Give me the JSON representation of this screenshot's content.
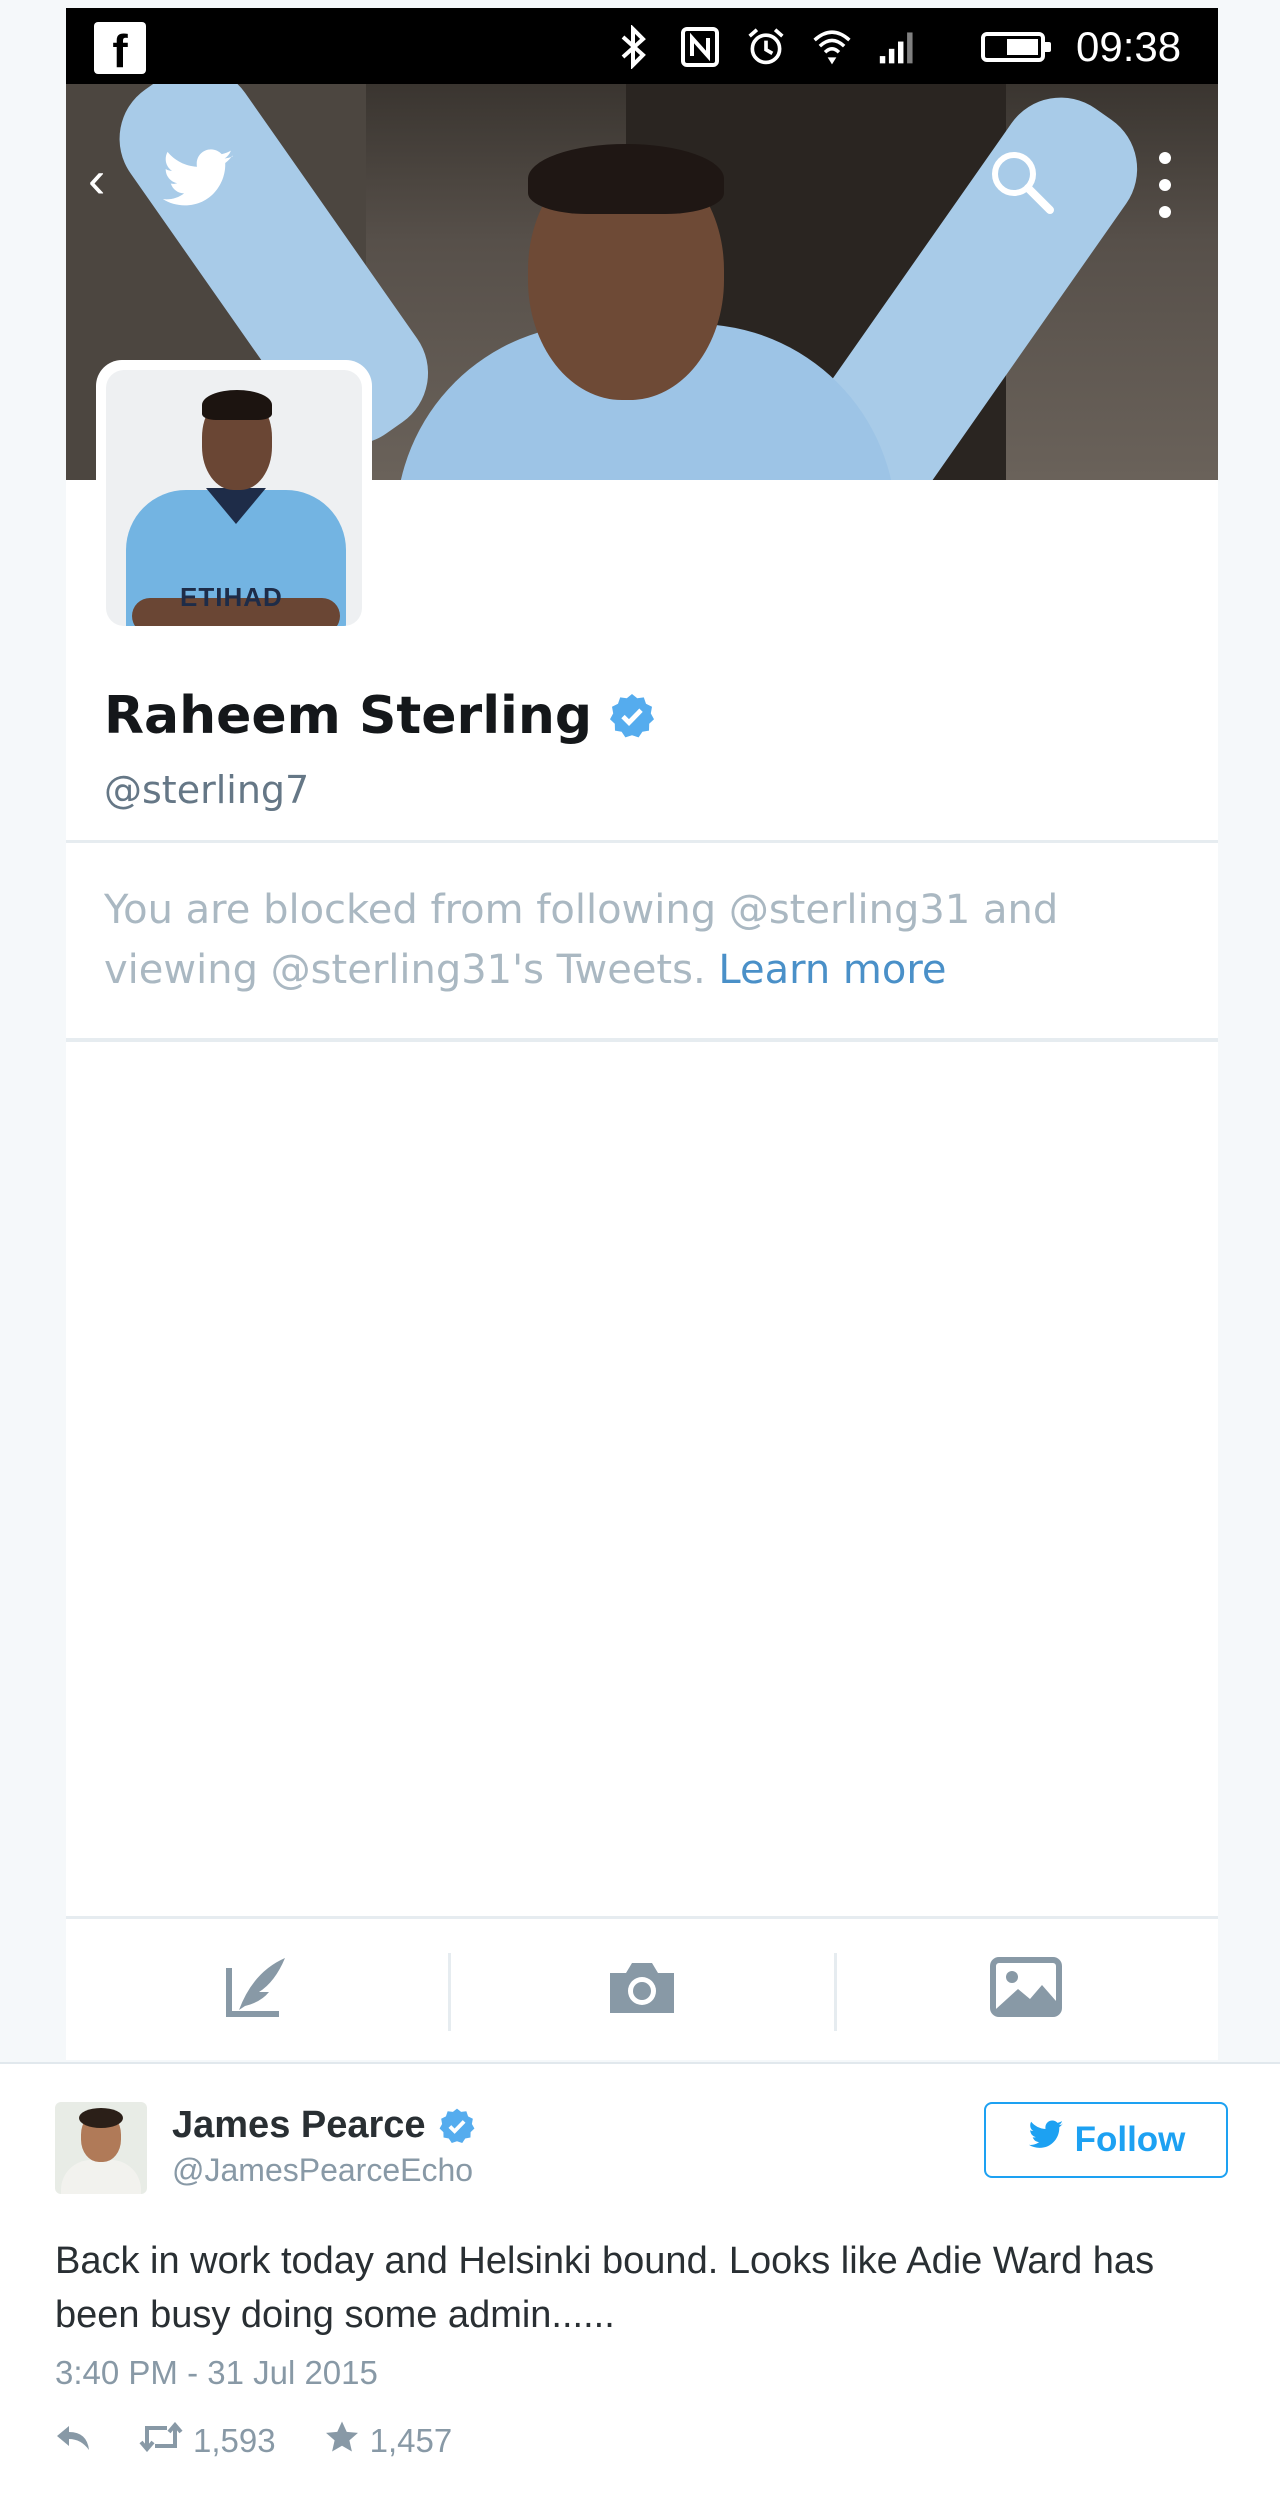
{
  "status_bar": {
    "time": "09:38",
    "left_icon": "facebook-icon",
    "icons": [
      "bluetooth-icon",
      "nfc-icon",
      "alarm-icon",
      "wifi-icon",
      "signal-icon",
      "battery-icon"
    ]
  },
  "profile": {
    "name": "Raheem Sterling",
    "handle": "@sterling7",
    "verified": true,
    "blocked_message": "You are blocked from following @sterling31 and viewing @sterling31's Tweets.",
    "learn_more": "Learn more"
  },
  "compose_bar": {
    "items": [
      "compose-icon",
      "camera-icon",
      "image-icon"
    ]
  },
  "tweet": {
    "author_name": "James Pearce",
    "author_handle": "@JamesPearceEcho",
    "verified": true,
    "follow_label": "Follow",
    "text": "Back in work today and Helsinki bound. Looks like Adie Ward has been busy doing some admin......",
    "timestamp": "3:40 PM - 31 Jul 2015",
    "retweets": "1,593",
    "favorites": "1,457"
  },
  "colors": {
    "twitter_blue": "#1da1f2",
    "verified_blue": "#55acee",
    "link": "#4a90c8",
    "muted_text": "#aab8c2"
  }
}
